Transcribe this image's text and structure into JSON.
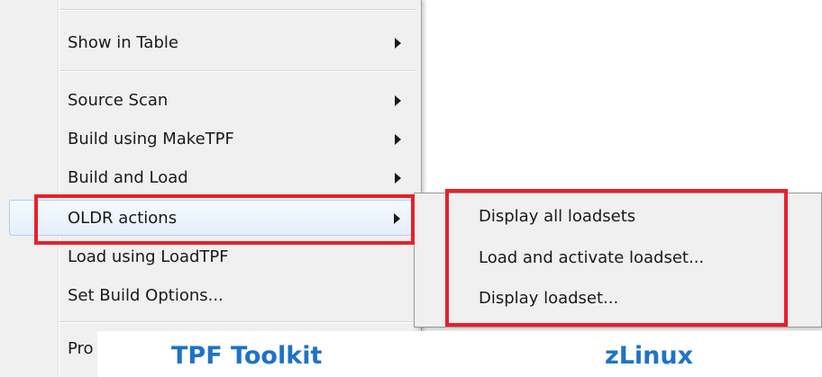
{
  "main_menu": {
    "items": [
      {
        "label": "Show in Table",
        "submenu": true
      },
      {
        "label": "Source Scan",
        "submenu": true
      },
      {
        "label": "Build using MakeTPF",
        "submenu": true
      },
      {
        "label": "Build and Load",
        "submenu": true
      },
      {
        "label": "OLDR actions",
        "submenu": true,
        "active": true
      },
      {
        "label": "Load using LoadTPF",
        "submenu": false
      },
      {
        "label": "Set Build Options...",
        "submenu": false
      },
      {
        "label": "Pro",
        "submenu": false,
        "partially_hidden": true
      }
    ]
  },
  "sub_menu": {
    "items": [
      {
        "label": "Display all loadsets"
      },
      {
        "label": "Load and activate loadset..."
      },
      {
        "label": "Display loadset..."
      }
    ]
  },
  "captions": {
    "left": "TPF Toolkit",
    "right": "zLinux"
  },
  "colors": {
    "highlight": "#e8202a",
    "caption": "#1e73c7",
    "menu_bg": "#f0f0f0"
  }
}
